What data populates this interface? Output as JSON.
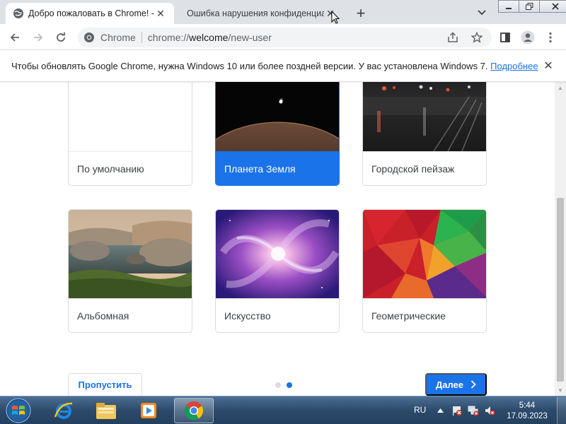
{
  "tabs": [
    {
      "title": "Добро пожаловать в Chrome! -",
      "active": true
    },
    {
      "title": "Ошибка нарушения конфиденциальности",
      "active": false
    }
  ],
  "toolbar": {
    "site_chip": "Chrome",
    "url_scheme": "chrome://",
    "url_host": "welcome",
    "url_path": "/new-user"
  },
  "infobar": {
    "message": "Чтобы обновлять Google Chrome, нужна Windows 10 или более поздней версии. У вас установлена Windows 7.",
    "link": "Подробнее"
  },
  "backgrounds": [
    {
      "label": "По умолчанию",
      "thumb": "blank",
      "selected": false
    },
    {
      "label": "Планета Земля",
      "thumb": "earth",
      "selected": true
    },
    {
      "label": "Городской пейзаж",
      "thumb": "city",
      "selected": false
    },
    {
      "label": "Альбомная",
      "thumb": "landscape",
      "selected": false
    },
    {
      "label": "Искусство",
      "thumb": "galaxy",
      "selected": false
    },
    {
      "label": "Геометрические",
      "thumb": "geometric",
      "selected": false
    }
  ],
  "actions": {
    "skip": "Пропустить",
    "next": "Далее"
  },
  "pager": {
    "total": 2,
    "current": 2
  },
  "taskbar": {
    "lang": "RU",
    "time": "5:44",
    "date": "17.09.2023"
  },
  "colors": {
    "accent": "#1a73e8",
    "tabstrip": "#dee1e6"
  }
}
